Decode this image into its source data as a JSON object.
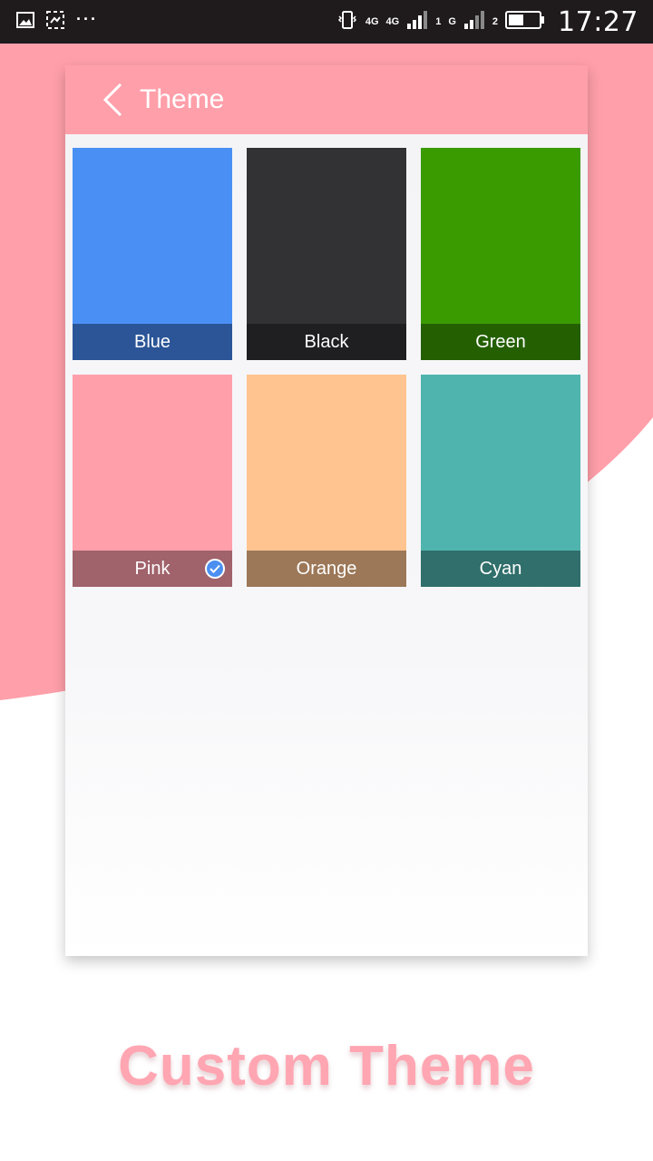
{
  "status_bar": {
    "time": "17:27",
    "network_1": "4G",
    "network_2": "4G",
    "sim_1": "1",
    "network_3": "G",
    "sim_2": "2",
    "more": "···"
  },
  "toolbar": {
    "title": "Theme"
  },
  "themes": [
    {
      "label": "Blue",
      "swatch": "#4a90f4",
      "bar": "#2b5597",
      "selected": false
    },
    {
      "label": "Black",
      "swatch": "#323234",
      "bar": "#1f1f21",
      "selected": false
    },
    {
      "label": "Green",
      "swatch": "#3a9b00",
      "bar": "#245f02",
      "selected": false
    },
    {
      "label": "Pink",
      "swatch": "#ff9faa",
      "bar": "#a0626b",
      "selected": true
    },
    {
      "label": "Orange",
      "swatch": "#ffc48f",
      "bar": "#9c7858",
      "selected": false
    },
    {
      "label": "Cyan",
      "swatch": "#4fb4ae",
      "bar": "#306f6b",
      "selected": false
    }
  ],
  "caption": "Custom Theme",
  "colors": {
    "accent": "#ff9faa",
    "selected_check": "#4b8ff0"
  }
}
